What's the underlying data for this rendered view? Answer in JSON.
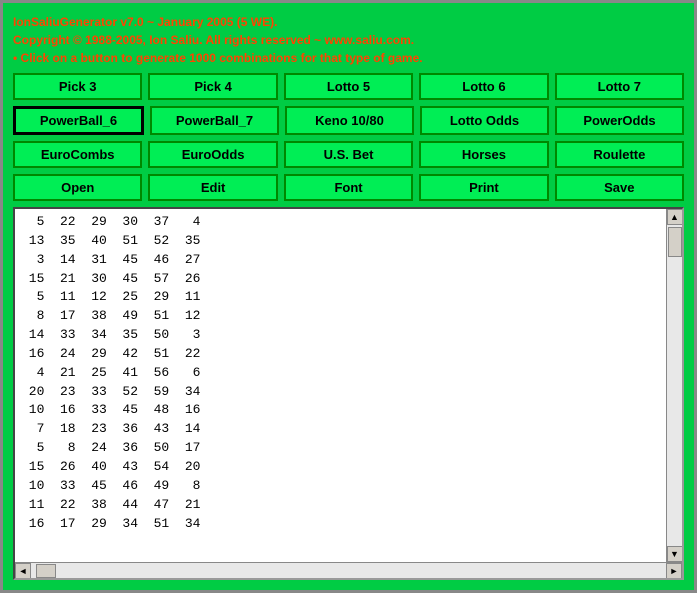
{
  "header": {
    "line1": "IonSaliuGenerator v7.0 ~ January 2005 (5 WE).",
    "line2": "Copyright © 1988-2005, Ion Saliu. All rights reserved ~ www.saliu.com.",
    "line3": "• Click on a button to generate 1000 combinations for that type of game."
  },
  "buttons": {
    "row1": [
      {
        "label": "Pick 3",
        "name": "pick3"
      },
      {
        "label": "Pick 4",
        "name": "pick4"
      },
      {
        "label": "Lotto 5",
        "name": "lotto5"
      },
      {
        "label": "Lotto 6",
        "name": "lotto6"
      },
      {
        "label": "Lotto 7",
        "name": "lotto7"
      }
    ],
    "row2": [
      {
        "label": "PowerBall_6",
        "name": "powerball6",
        "active": true
      },
      {
        "label": "PowerBall_7",
        "name": "powerball7"
      },
      {
        "label": "Keno 10/80",
        "name": "keno"
      },
      {
        "label": "Lotto Odds",
        "name": "lotto-odds"
      },
      {
        "label": "PowerOdds",
        "name": "power-odds"
      }
    ],
    "row3": [
      {
        "label": "EuroCombs",
        "name": "euro-combs"
      },
      {
        "label": "EuroOdds",
        "name": "euro-odds"
      },
      {
        "label": "U.S. Bet",
        "name": "us-bet"
      },
      {
        "label": "Horses",
        "name": "horses"
      },
      {
        "label": "Roulette",
        "name": "roulette"
      }
    ],
    "row4": [
      {
        "label": "Open",
        "name": "open"
      },
      {
        "label": "Edit",
        "name": "edit"
      },
      {
        "label": "Font",
        "name": "font"
      },
      {
        "label": "Print",
        "name": "print"
      },
      {
        "label": "Save",
        "name": "save"
      }
    ]
  },
  "output": {
    "lines": [
      "  5  22  29  30  37   4",
      " 13  35  40  51  52  35",
      "  3  14  31  45  46  27",
      " 15  21  30  45  57  26",
      "  5  11  12  25  29  11",
      "  8  17  38  49  51  12",
      " 14  33  34  35  50   3",
      " 16  24  29  42  51  22",
      "  4  21  25  41  56   6",
      " 20  23  33  52  59  34",
      " 10  16  33  45  48  16",
      "  7  18  23  36  43  14",
      "  5   8  24  36  50  17",
      " 15  26  40  43  54  20",
      " 10  33  45  46  49   8",
      " 11  22  38  44  47  21",
      " 16  17  29  34  51  34"
    ]
  }
}
